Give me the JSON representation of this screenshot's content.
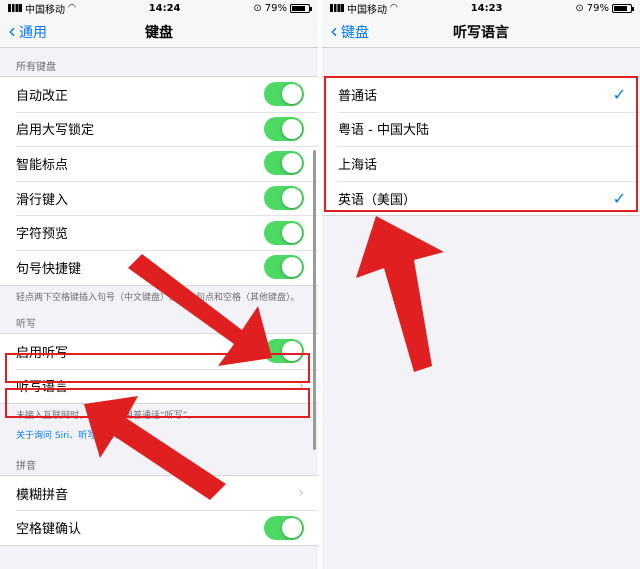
{
  "status_left": {
    "carrier": "中国移动",
    "time": "14:24",
    "battery": "79%"
  },
  "status_right": {
    "carrier": "中国移动",
    "time": "14:23",
    "battery": "79%"
  },
  "left": {
    "back_label": "通用",
    "title": "键盘",
    "section_keyboards": "所有键盘",
    "keyboard_rows": [
      {
        "label": "自动改正",
        "on": true
      },
      {
        "label": "启用大写锁定",
        "on": true
      },
      {
        "label": "智能标点",
        "on": true
      },
      {
        "label": "滑行键入",
        "on": true
      },
      {
        "label": "字符预览",
        "on": true
      },
      {
        "label": "句号快捷键",
        "on": true
      }
    ],
    "keyboard_footer": "轻点两下空格键插入句号（中文键盘）或插入句点和空格（其他键盘）。",
    "section_dictation": "听写",
    "dictation_toggle_label": "启用听写",
    "dictation_toggle_on": true,
    "dictation_language_label": "听写语言",
    "dictation_footer": "未接入互联网时，听写将使用普通话“听写”。",
    "privacy_link": "关于询问 Siri、听写与隐私…",
    "section_pinyin": "拼音",
    "fuzzy_pinyin_label": "模糊拼音",
    "space_confirm_label": "空格键确认",
    "space_confirm_on": true
  },
  "right": {
    "back_label": "键盘",
    "title": "听写语言",
    "languages": [
      {
        "label": "普通话",
        "checked": true
      },
      {
        "label": "粤语 - 中国大陆",
        "checked": false
      },
      {
        "label": "上海话",
        "checked": false
      },
      {
        "label": "英语（美国）",
        "checked": true
      }
    ]
  },
  "icons": {
    "checkmark": "✓",
    "chevron": "›",
    "back_chevron": "‹"
  },
  "colors": {
    "accent": "#007aff",
    "toggle_on": "#4cd964",
    "annotation": "#e02020"
  }
}
